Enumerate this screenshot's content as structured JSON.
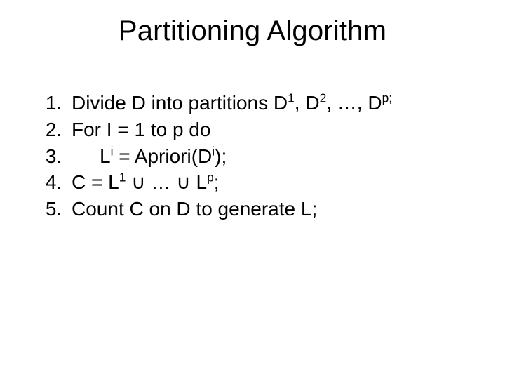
{
  "title": "Partitioning Algorithm",
  "steps": {
    "s1": {
      "a": "Divide D into partitions D",
      "sup1": "1",
      "b": ", D",
      "sup2": "2",
      "c": ", …, D",
      "sup3": "p;"
    },
    "s2": {
      "a": "For I = 1 to p do"
    },
    "s3": {
      "a": "L",
      "sup1": "i",
      "b": " = Apriori(D",
      "sup2": "i",
      "c": ");"
    },
    "s4": {
      "a": "C = L",
      "sup1": "1",
      "b": " ",
      "cup1": "∪",
      "c": " … ",
      "cup2": "∪",
      "d": " L",
      "sup2": "p",
      "e": ";"
    },
    "s5": {
      "a": "Count C on D to generate L;"
    }
  }
}
